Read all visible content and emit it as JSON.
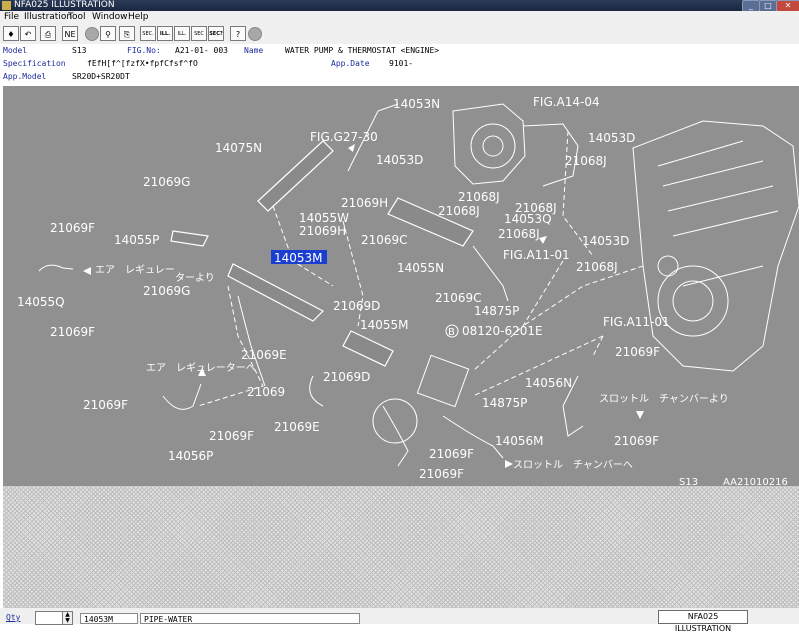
{
  "window": {
    "title": "NFA025 ILLUSTRATION",
    "min": "_",
    "max": "□",
    "close": "✕"
  },
  "menu": [
    "File",
    "Illustration",
    "Tool",
    "Window",
    "Help"
  ],
  "toolbar": {
    "buttons": [
      {
        "name": "exit-icon",
        "glyph": "♦"
      },
      {
        "name": "undo-icon",
        "glyph": "↶"
      },
      {
        "name": "print-icon",
        "glyph": "⎙"
      },
      {
        "name": "text-icon",
        "glyph": "NE"
      },
      {
        "name": "circle-gray-icon",
        "glyph": ""
      },
      {
        "name": "magnify-icon",
        "glyph": "⚲"
      },
      {
        "name": "page-icon",
        "glyph": "⎘"
      },
      {
        "name": "sec-icon",
        "glyph": "SEC."
      },
      {
        "name": "ill-bold-icon",
        "glyph": "ILL."
      },
      {
        "name": "ill-icon",
        "glyph": "ILL."
      },
      {
        "name": "sec-light-icon",
        "glyph": "SEC"
      },
      {
        "name": "sec-question-icon",
        "glyph": "SEC?"
      },
      {
        "name": "help-icon",
        "glyph": "?"
      },
      {
        "name": "circle-gray-2-icon",
        "glyph": ""
      }
    ]
  },
  "info": {
    "model_label": "Model",
    "model_value": "S13",
    "fig_label": "FIG.No:",
    "fig_value": "A21-01- 003",
    "name_label": "Name",
    "name_value": "WATER PUMP & THERMOSTAT    <ENGINE>",
    "spec_label": "Specification",
    "spec_value": "fEfH[f^[fzfX•fpfCfsf^fO",
    "appdate_label": "App.Date",
    "appdate_value": "9101-",
    "appmodel_label": "App.Model",
    "appmodel_value": "SR20D+SR20DT"
  },
  "illustration": {
    "highlighted_callout": "14053M",
    "callouts": [
      "14053N",
      "FIG.A14-04",
      "FIG.G27-30",
      "14075N",
      "14053D",
      "14053D",
      "21068J",
      "21069G",
      "21069H",
      "21068J",
      "21068J",
      "21068J",
      "14053Q",
      "14055W",
      "21069H",
      "21069F",
      "14055P",
      "21069C",
      "14055N",
      "21068J",
      "14053D",
      "エア　レギュレー",
      "ターより",
      "21069G",
      "FIG.A11-01",
      "21068J",
      "14055Q",
      "21069F",
      "21069C",
      "14875P",
      "21069D",
      "14055M",
      "08120-6201E",
      "FIG.A11-01",
      "21069E",
      "21069F",
      "エア　レギュレーターへ",
      "21069D",
      "14056N",
      "21069F",
      "21069",
      "14875P",
      "スロットル　チャンバーより",
      "21069E",
      "21069F",
      "14056M",
      "21069F",
      "14056P",
      "21069F",
      "21069F",
      "スロットル　チャンバーへ",
      "S13",
      "AA21010216",
      "B"
    ]
  },
  "status": {
    "qty_label": "Qty",
    "qty_value": "",
    "part_no": "14053M",
    "part_name": "PIPE-WATER",
    "taskbar_item": "NFA025 ILLUSTRATION"
  }
}
